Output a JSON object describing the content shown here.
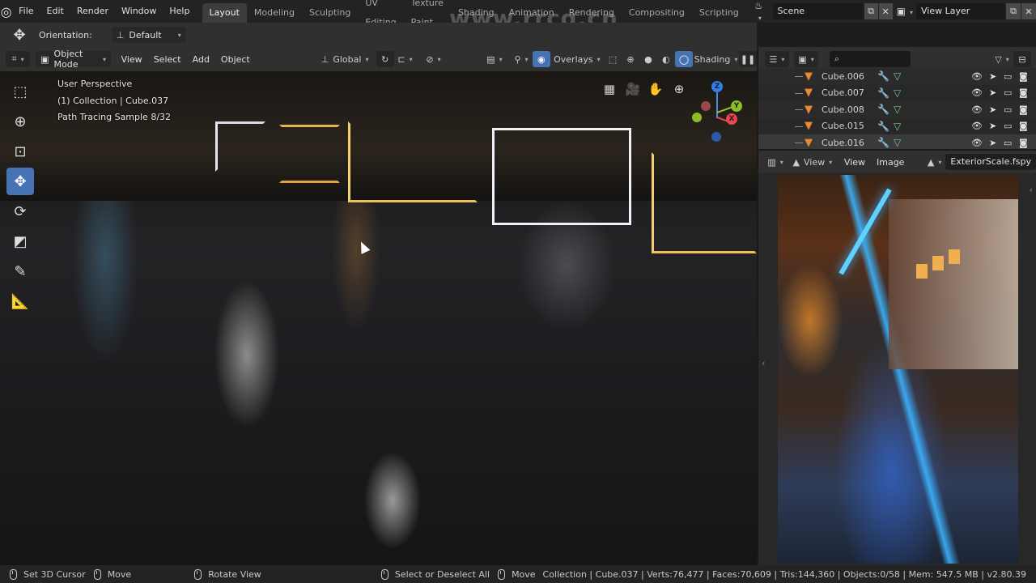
{
  "app": {
    "logo_icon": "blender-logo-icon",
    "menu": [
      "File",
      "Edit",
      "Render",
      "Window",
      "Help"
    ],
    "workspace_tabs": [
      {
        "label": "Layout",
        "active": true
      },
      {
        "label": "Modeling",
        "active": false
      },
      {
        "label": "Sculpting",
        "active": false
      },
      {
        "label": "UV Editing",
        "active": false
      },
      {
        "label": "Texture Paint",
        "active": false
      },
      {
        "label": "Shading",
        "active": false
      },
      {
        "label": "Animation",
        "active": false
      },
      {
        "label": "Rendering",
        "active": false
      },
      {
        "label": "Compositing",
        "active": false
      },
      {
        "label": "Scripting",
        "active": false
      }
    ],
    "scene": "Scene",
    "view_layer": "View Layer",
    "watermark": "www.rrcg.cn"
  },
  "tool_settings": {
    "orientation_label": "Orientation:",
    "orientation_value": "Default"
  },
  "viewport_header": {
    "mode": "Object Mode",
    "menus": [
      "View",
      "Select",
      "Add",
      "Object"
    ],
    "transform_orientation": "Global",
    "overlays_label": "Overlays",
    "shading_label": "Shading",
    "colors": {
      "active_button": "#4772b3"
    }
  },
  "viewport": {
    "overlay_lines": [
      "User Perspective",
      "(1) Collection | Cube.037",
      "Path Tracing Sample 8/32"
    ],
    "tools": [
      {
        "name": "select-box-tool",
        "glyph": "⬚",
        "active": false
      },
      {
        "name": "cursor-tool",
        "glyph": "⊕",
        "active": false
      },
      {
        "name": "transform-tool",
        "glyph": "⊡",
        "active": false
      },
      {
        "name": "move-tool",
        "glyph": "✥",
        "active": true
      },
      {
        "name": "rotate-tool",
        "glyph": "⟳",
        "active": false
      },
      {
        "name": "scale-tool",
        "glyph": "◩",
        "active": false
      },
      {
        "name": "annotate-tool",
        "glyph": "✎",
        "active": false
      },
      {
        "name": "measure-tool",
        "glyph": "📐",
        "active": false
      }
    ],
    "gizmo_axes": {
      "x": "X",
      "y": "Y",
      "z": "Z"
    },
    "axis_colors": {
      "x": "#e8474e",
      "y": "#8cbf26",
      "z": "#2f7fe8"
    }
  },
  "outliner": {
    "items": [
      {
        "name": "Cube.006",
        "selected": false
      },
      {
        "name": "Cube.007",
        "selected": false
      },
      {
        "name": "Cube.008",
        "selected": false
      },
      {
        "name": "Cube.015",
        "selected": false
      },
      {
        "name": "Cube.016",
        "selected": true
      }
    ]
  },
  "image_editor": {
    "view_dropdown": "View",
    "menus": [
      "View",
      "Image"
    ],
    "image_name": "ExteriorScale.fspy"
  },
  "status_bar": {
    "hints": [
      {
        "label": "Set 3D Cursor",
        "icon": "mouse-left-icon"
      },
      {
        "label": "Move",
        "icon": "mouse-drag-icon"
      },
      {
        "label": "Rotate View",
        "icon": "mouse-middle-icon"
      },
      {
        "label": "Select or Deselect All",
        "icon": "mouse-left-icon"
      },
      {
        "label": "Move",
        "icon": "mouse-drag-icon"
      }
    ],
    "stats": "Collection | Cube.037 | Verts:76,477 | Faces:70,609 | Tris:144,360 | Objects:0/58 | Mem: 547.5 MB | v2.80.39"
  }
}
